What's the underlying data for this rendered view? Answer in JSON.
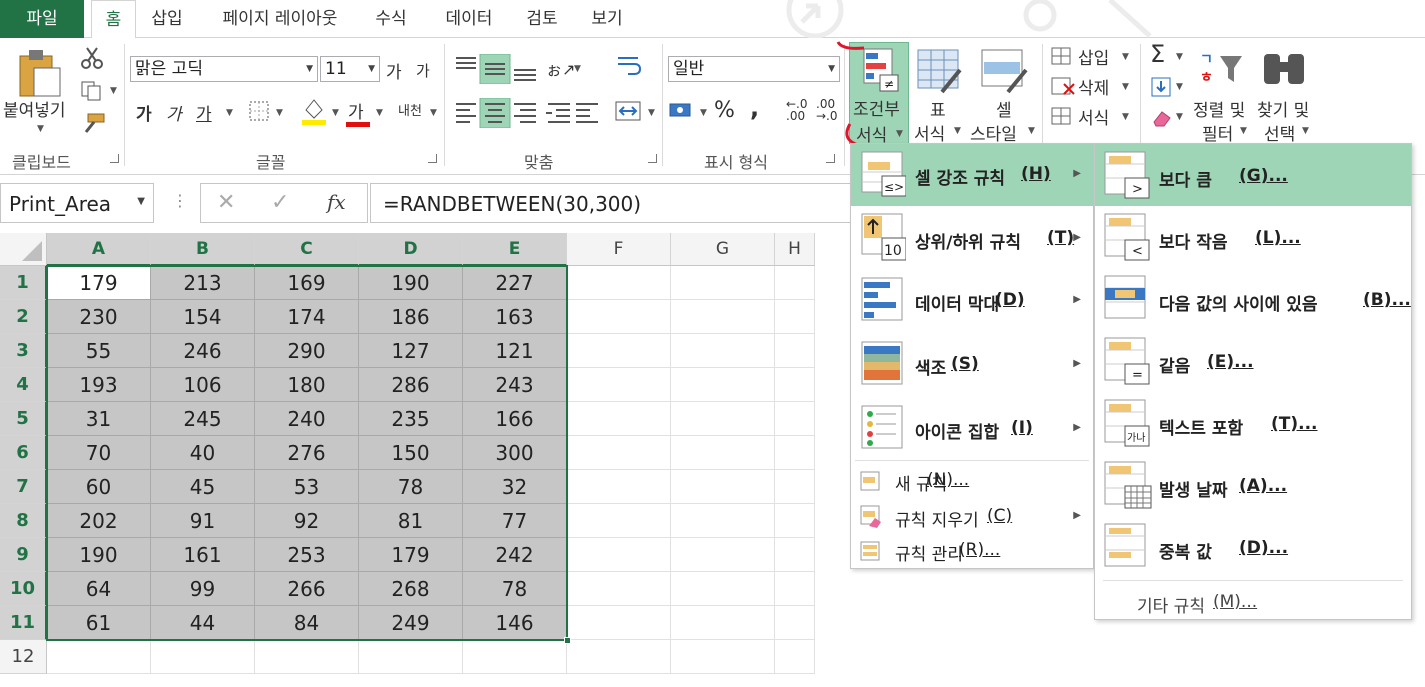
{
  "tabs": [
    "파일",
    "홈",
    "삽입",
    "페이지 레이아웃",
    "수식",
    "데이터",
    "검토",
    "보기"
  ],
  "ribbon": {
    "clipboard": {
      "paste": "붙여넣기",
      "group": "클립보드"
    },
    "font": {
      "name": "맑은 고딕",
      "size": "11",
      "grow": "가",
      "shrink": "가",
      "bold": "가",
      "italic": "가",
      "underline": "가",
      "fill_letter": "가",
      "phonetic": "내천",
      "group": "글꼴"
    },
    "align": {
      "group": "맞춤"
    },
    "number": {
      "format": "일반",
      "percent": "%",
      "comma": ",",
      "group": "표시 형식"
    },
    "styles": {
      "conditional_line1": "조건부",
      "conditional_line2": "서식",
      "table_line1": "표",
      "table_line2": "서식",
      "cell_line1": "셀",
      "cell_line2": "스타일"
    },
    "cells": {
      "insert": "삽입",
      "delete": "삭제",
      "format": "서식"
    },
    "editing": {
      "sum": "Σ",
      "sort_line1": "정렬 및",
      "sort_line2": "필터",
      "find_line1": "찾기 및",
      "find_line2": "선택"
    }
  },
  "formula_bar": {
    "name_box": "Print_Area",
    "cancel": "✕",
    "enter": "✓",
    "fx": "fx",
    "formula": "=RANDBETWEEN(30,300)"
  },
  "sheet": {
    "columns": [
      "A",
      "B",
      "C",
      "D",
      "E",
      "F",
      "G",
      "H"
    ],
    "rows": [
      "1",
      "2",
      "3",
      "4",
      "5",
      "6",
      "7",
      "8",
      "9",
      "10",
      "11",
      "12"
    ],
    "values": [
      [
        "179",
        "213",
        "169",
        "190",
        "227"
      ],
      [
        "230",
        "154",
        "174",
        "186",
        "163"
      ],
      [
        "55",
        "246",
        "290",
        "127",
        "121"
      ],
      [
        "193",
        "106",
        "180",
        "286",
        "243"
      ],
      [
        "31",
        "245",
        "240",
        "235",
        "166"
      ],
      [
        "70",
        "40",
        "276",
        "150",
        "300"
      ],
      [
        "60",
        "45",
        "53",
        "78",
        "32"
      ],
      [
        "202",
        "91",
        "92",
        "81",
        "77"
      ],
      [
        "190",
        "161",
        "253",
        "179",
        "242"
      ],
      [
        "64",
        "99",
        "266",
        "268",
        "78"
      ],
      [
        "61",
        "44",
        "84",
        "249",
        "146"
      ]
    ]
  },
  "menu_conditional": {
    "items": [
      {
        "text": "셀 강조 규칙",
        "key": "(H)"
      },
      {
        "text": "상위/하위 규칙",
        "key": "(T)"
      },
      {
        "text": "데이터 막대",
        "key": "(D)"
      },
      {
        "text": "색조",
        "key": "(S)"
      },
      {
        "text": "아이콘 집합",
        "key": "(I)"
      }
    ],
    "bottom": [
      {
        "text": "새 규칙",
        "key": "(N)..."
      },
      {
        "text": "규칙 지우기",
        "key": "(C)"
      },
      {
        "text": "규칙 관리",
        "key": "(R)..."
      }
    ]
  },
  "menu_highlight": {
    "items": [
      {
        "text": "보다 큼",
        "key": "(G)..."
      },
      {
        "text": "보다 작음",
        "key": "(L)..."
      },
      {
        "text": "다음 값의 사이에 있음",
        "key": "(B)..."
      },
      {
        "text": "같음",
        "key": "(E)..."
      },
      {
        "text": "텍스트 포함",
        "key": "(T)..."
      },
      {
        "text": "발생 날짜",
        "key": "(A)..."
      },
      {
        "text": "중복 값",
        "key": "(D)..."
      }
    ],
    "more": {
      "text": "기타 규칙",
      "key": "(M)..."
    },
    "icon_glyphs": [
      ">",
      "<",
      "",
      "=",
      "가나",
      "",
      ""
    ],
    "top_icon_glyphs": [
      "≤>",
      "10"
    ]
  },
  "colors": {
    "excel_green": "#217346",
    "selection_green": "#9fd5b7",
    "cell_shade": "#c6c6c6",
    "annotation_red": "#e0142d"
  }
}
